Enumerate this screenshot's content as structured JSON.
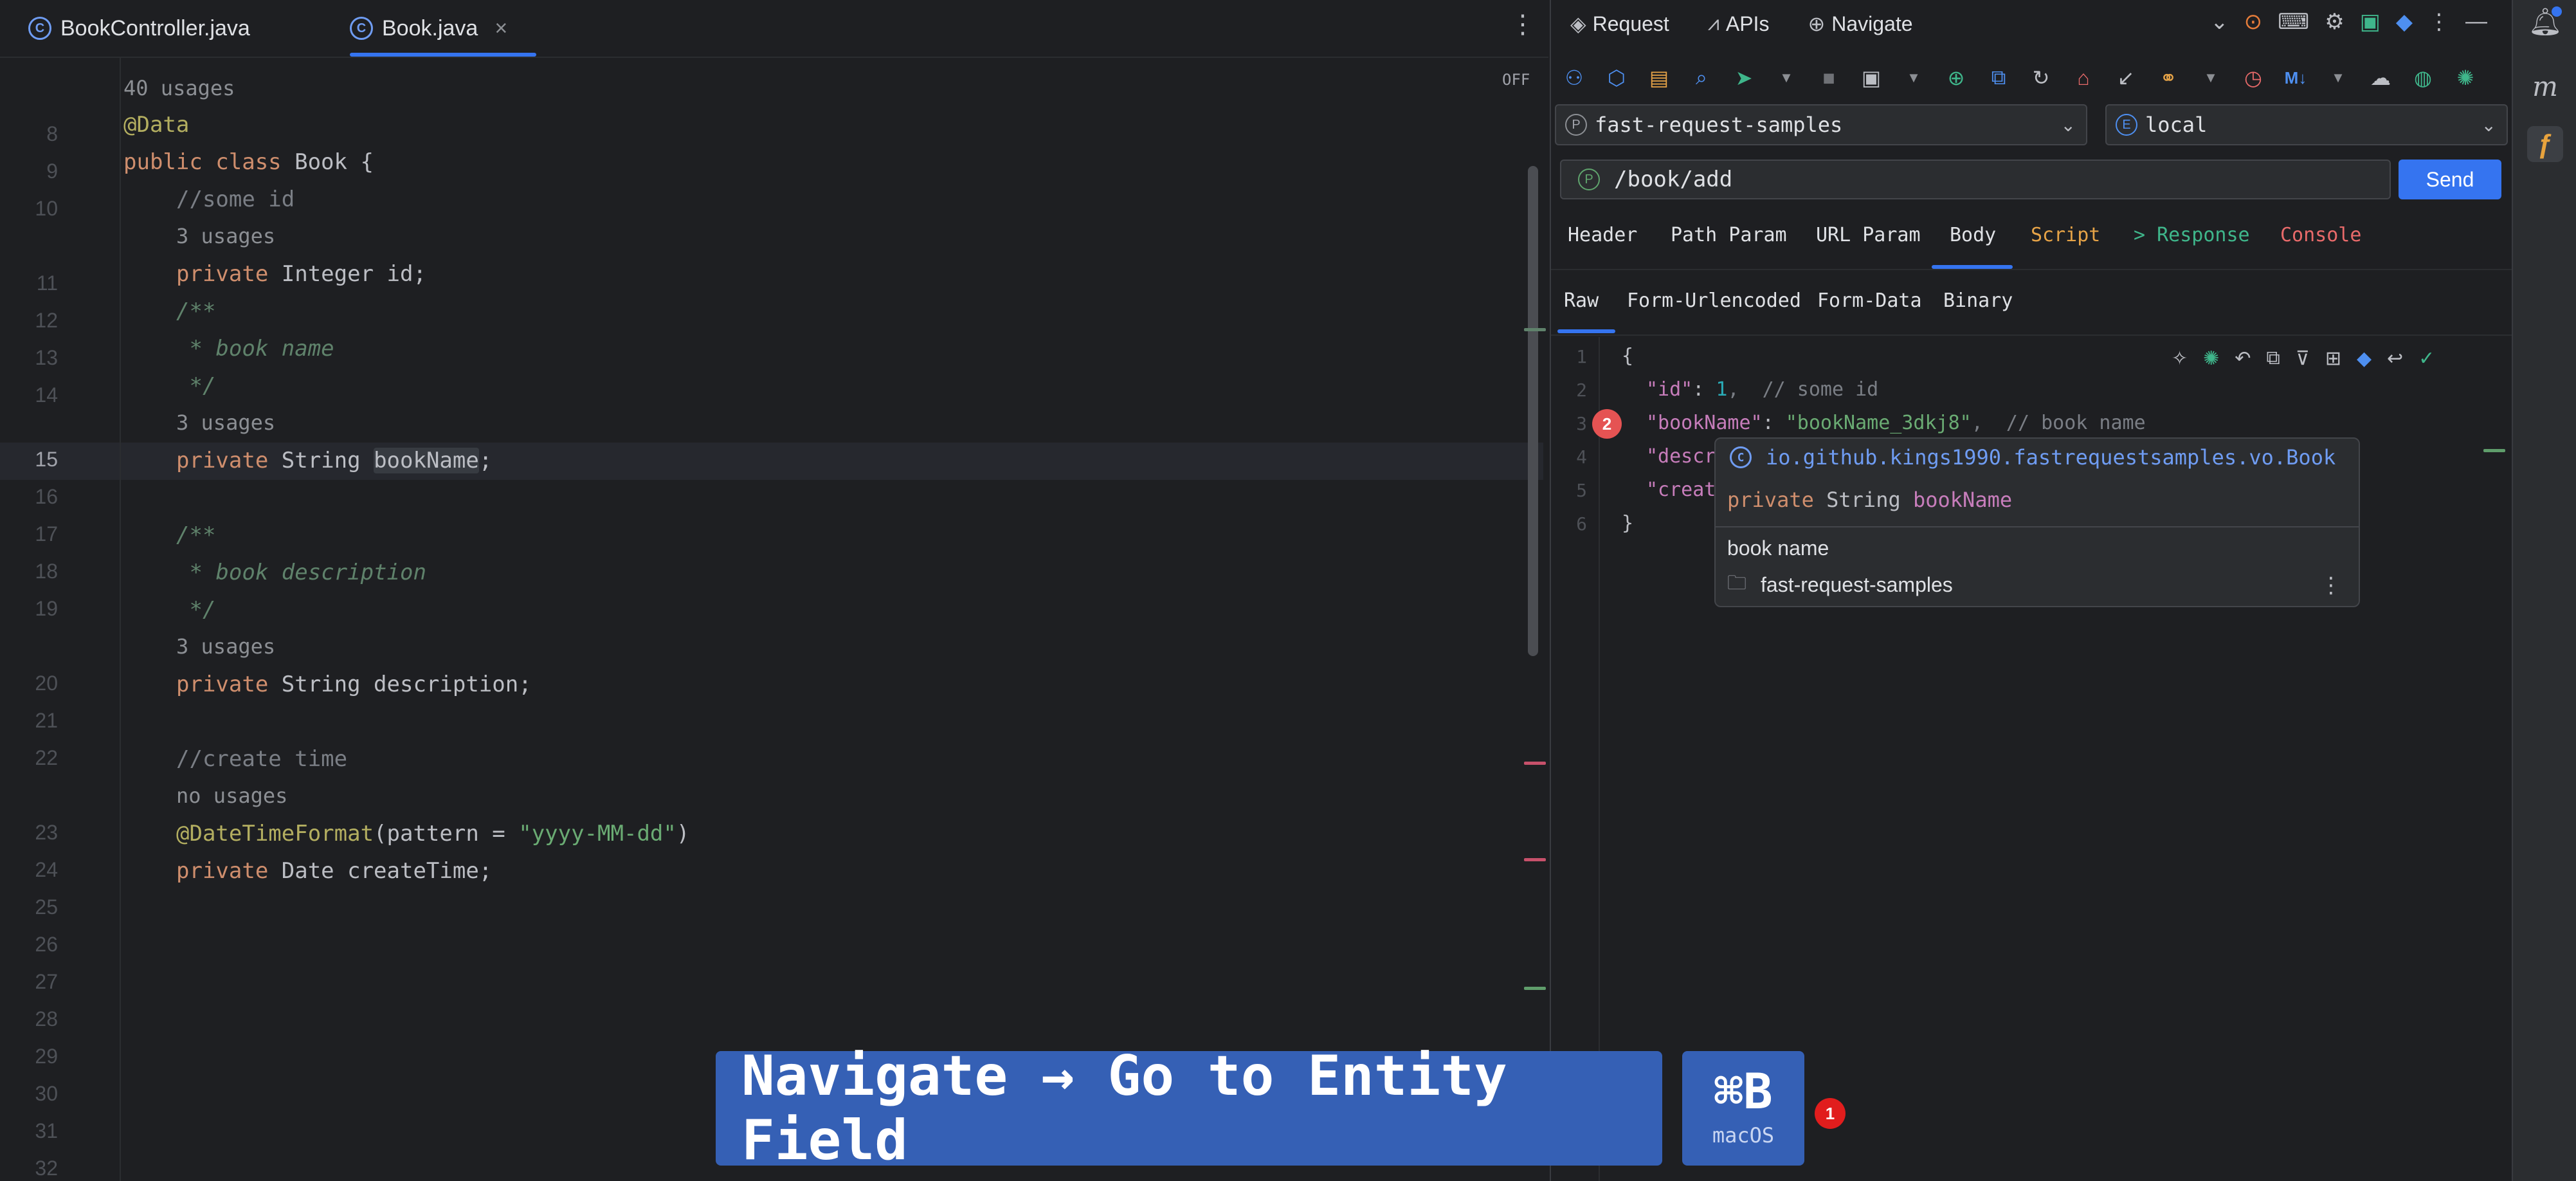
{
  "editor": {
    "tabs": [
      {
        "label": "BookController.java",
        "icon": "class-icon"
      },
      {
        "label": "Book.java",
        "icon": "class-icon",
        "close": "×"
      }
    ],
    "off_label": "OFF",
    "usages": {
      "u40": "40 usages",
      "u3a": "3 usages",
      "u3b": "3 usages",
      "u3c": "3 usages",
      "none": "no usages"
    },
    "line_numbers": [
      "8",
      "9",
      "10",
      "11",
      "12",
      "13",
      "14",
      "15",
      "16",
      "17",
      "18",
      "19",
      "20",
      "21",
      "22",
      "23",
      "24",
      "25",
      "26",
      "27",
      "28",
      "29",
      "30",
      "31",
      "32"
    ],
    "code": {
      "l8": "@Data",
      "l9_kw": "public class ",
      "l9_rest": "Book {",
      "l10": "//some id",
      "l11_kw": "private ",
      "l11_rest": "Integer id;",
      "l12": "/**",
      "l13": " * book name",
      "l14": " */",
      "l15_kw": "private ",
      "l15_type": "String ",
      "l15_name": "bookName",
      "l15_end": ";",
      "l17": "/**",
      "l18": " * book description",
      "l19": " */",
      "l20_kw": "private ",
      "l20_rest": "String description;",
      "l22": "//create time",
      "l23_ann": "@DateTimeFormat",
      "l23_mid": "(pattern = ",
      "l23_str": "\"yyyy-MM-dd\"",
      "l23_end": ")",
      "l24_kw": "private ",
      "l24_rest": "Date createTime;"
    }
  },
  "panel": {
    "tabs": [
      {
        "label": "Request",
        "icon": "request-icon"
      },
      {
        "label": "APIs",
        "icon": "apis-icon"
      },
      {
        "label": "Navigate",
        "icon": "navigate-icon"
      }
    ],
    "project": "fast-request-samples",
    "project_badge": "P",
    "env": "local",
    "env_badge": "E",
    "url": "/book/add",
    "url_badge": "P",
    "send_label": "Send",
    "req_tabs": [
      "Header",
      "Path Param",
      "URL Param",
      "Body",
      "Script",
      "> Response",
      "Console"
    ],
    "body_tabs": [
      "Raw",
      "Form-Urlencoded",
      "Form-Data",
      "Binary"
    ],
    "json": {
      "lines": [
        "1",
        "2",
        "3",
        "4",
        "5",
        "6"
      ],
      "open": "{",
      "l2_key": "\"id\"",
      "l2_colon": ": ",
      "l2_val": "1",
      "l2_cmt": ",  // some id",
      "l3_key": "\"bookName\"",
      "l3_colon": ": ",
      "l3_val": "\"bookName_3dkj8\"",
      "l3_cmt": ",  // book name",
      "l4_key": "\"descr",
      "l5_key": "\"creat",
      "close": "}"
    },
    "error_count": "2"
  },
  "popup": {
    "fqcn": "io.github.kings1990.fastrequestsamples.vo.Book",
    "sig_kw": "private ",
    "sig_type": "String ",
    "sig_name": "bookName",
    "doc": "book name",
    "module": "fast-request-samples"
  },
  "overlay": {
    "action": "Navigate → Go to Entity Field",
    "shortcut": "⌘B",
    "os": "macOS",
    "step": "1"
  },
  "colors": {
    "accent": "#3574f0",
    "banner": "#3560b5",
    "script_tab": "#e6a347",
    "response_tab": "#3fb68b",
    "console_tab": "#e86a6a"
  }
}
